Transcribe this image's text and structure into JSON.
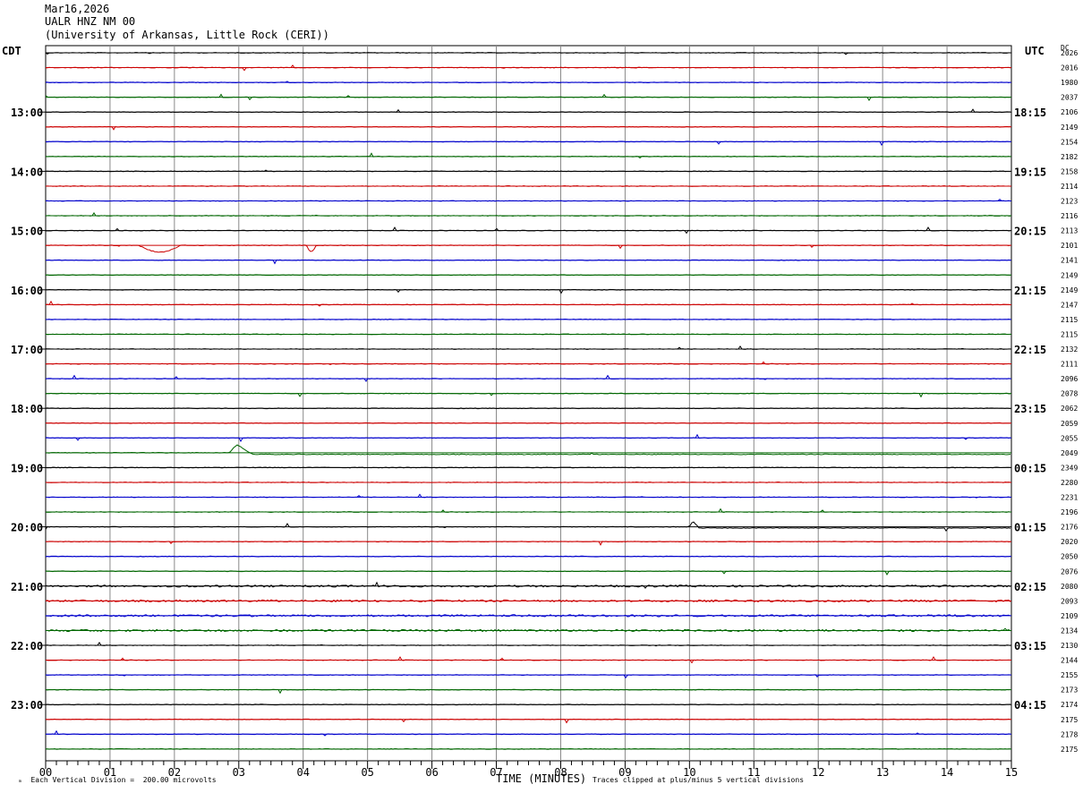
{
  "header": {
    "date": "Mar16,2026",
    "station": "UALR HNZ NM 00",
    "institution": "(University of Arkansas, Little Rock (CERI))"
  },
  "left_timezone": "CDT",
  "right_timezone": "UTC",
  "dc_header": "DC",
  "footer": {
    "scale_note": "Each Vertical Division =  200.00 microvolts",
    "clip_note": "Traces clipped at plus/minus 5 vertical divisions",
    "corner_mark": "ₘ"
  },
  "colors": {
    "black": "#000000",
    "red": "#cc0000",
    "blue": "#0000cc",
    "green": "#006600",
    "grid": "#888888"
  },
  "chart_data": {
    "type": "line",
    "title": "UALR HNZ NM 00",
    "xlabel": "TIME (MINUTES)",
    "xlim": [
      0,
      15
    ],
    "x_ticks": [
      "00",
      "01",
      "02",
      "03",
      "04",
      "05",
      "06",
      "07",
      "08",
      "09",
      "10",
      "11",
      "12",
      "13",
      "14",
      "15"
    ],
    "trace_count": 48,
    "traces_per_hour": 4,
    "trace_color_cycle": [
      "black",
      "red",
      "blue",
      "green"
    ],
    "left_hour_labels": [
      "13:00",
      "14:00",
      "15:00",
      "16:00",
      "17:00",
      "18:00",
      "19:00",
      "20:00",
      "21:00",
      "22:00",
      "23:00"
    ],
    "right_hour_labels": [
      "18:15",
      "19:15",
      "20:15",
      "21:15",
      "22:15",
      "23:15",
      "00:15",
      "01:15",
      "02:15",
      "03:15",
      "04:15"
    ],
    "dc_values": [
      "2026",
      "2016",
      "1980",
      "2037",
      "2106",
      "2149",
      "2154",
      "2182",
      "2158",
      "2114",
      "2123",
      "2116",
      "2113",
      "2101",
      "2141",
      "2149",
      "2149",
      "2147",
      "2115",
      "2115",
      "2132",
      "2111",
      "2096",
      "2078",
      "2062",
      "2059",
      "2055",
      "2049",
      "2349",
      "2280",
      "2231",
      "2196",
      "2176",
      "2020",
      "2050",
      "2076",
      "2080",
      "2093",
      "2109",
      "2134",
      "2130",
      "2144",
      "2155",
      "2173",
      "2174",
      "2175",
      "2178",
      "2175"
    ],
    "events": [
      {
        "trace": 13,
        "start_min": 1.45,
        "end_min": 2.1,
        "offset_div": 0.45
      },
      {
        "trace": 13,
        "start_min": 4.05,
        "end_min": 4.2,
        "offset_div": 0.4
      },
      {
        "trace": 27,
        "start_min": 2.85,
        "end_min": 15.0,
        "offset_div": 0.55
      },
      {
        "trace": 32,
        "start_min": 10.0,
        "end_min": 15.0,
        "offset_div": 0.4
      }
    ]
  }
}
